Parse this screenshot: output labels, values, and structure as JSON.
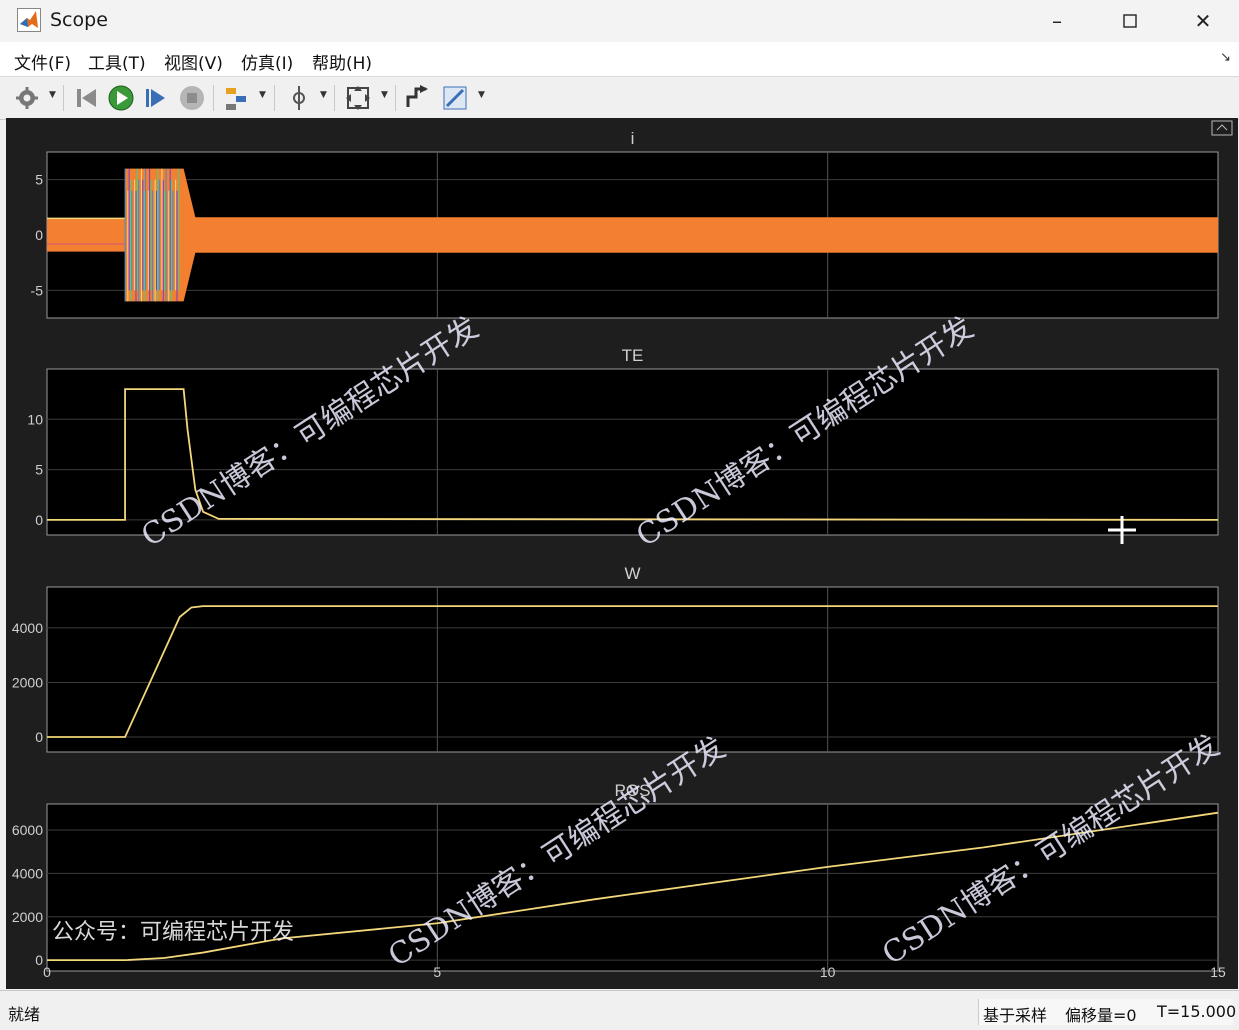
{
  "window": {
    "title": "Scope"
  },
  "menu": [
    {
      "label": "文件(F)"
    },
    {
      "label": "工具(T)"
    },
    {
      "label": "视图(V)"
    },
    {
      "label": "仿真(I)"
    },
    {
      "label": "帮助(H)"
    }
  ],
  "toolbar": {
    "icons": [
      "settings-icon",
      "step-back-icon",
      "run-icon",
      "step-forward-icon",
      "stop-icon",
      "highlight-icon",
      "cursor-measure-icon",
      "zoom-fit-icon",
      "restore-layout-icon",
      "style-icon"
    ]
  },
  "plots": [
    {
      "title": "i",
      "ylim": [
        -7.5,
        7.5
      ],
      "yticks": [
        "5",
        "0",
        "-5"
      ]
    },
    {
      "title": "TE",
      "ylim": [
        -1.5,
        15
      ],
      "yticks": [
        "10",
        "5",
        "0"
      ]
    },
    {
      "title": "W",
      "ylim": [
        -550,
        5500
      ],
      "yticks": [
        "4000",
        "2000",
        "0"
      ]
    },
    {
      "title": "POS",
      "ylim": [
        -500,
        7200
      ],
      "yticks": [
        "6000",
        "4000",
        "2000",
        "0"
      ]
    }
  ],
  "xaxis": {
    "ticks": [
      "0",
      "5",
      "10",
      "15"
    ]
  },
  "chart_data": [
    {
      "type": "line",
      "title": "i",
      "x_range": [
        0,
        15
      ],
      "ylim": [
        -7.5,
        7.5
      ],
      "series": [
        {
          "x": [
            0,
            1,
            1,
            1.75,
            1.9,
            15
          ],
          "values": [
            1.5,
            1.5,
            6,
            6,
            1.6,
            1.6
          ]
        }
      ]
    },
    {
      "type": "line",
      "title": "TE",
      "x_range": [
        0,
        15
      ],
      "ylim": [
        -1.5,
        15
      ],
      "series": [
        {
          "x": [
            0,
            1,
            1,
            1.75,
            1.8,
            1.9,
            2.0,
            2.2,
            15
          ],
          "values": [
            0,
            0,
            13,
            13,
            9,
            3,
            0.8,
            0.1,
            0
          ]
        }
      ]
    },
    {
      "type": "line",
      "title": "W",
      "x_range": [
        0,
        15
      ],
      "ylim": [
        -550,
        5500
      ],
      "series": [
        {
          "x": [
            0,
            1,
            1.7,
            1.85,
            2.0,
            15
          ],
          "values": [
            0,
            0,
            4400,
            4750,
            4800,
            4800
          ]
        }
      ]
    },
    {
      "type": "line",
      "title": "POS",
      "x_range": [
        0,
        15
      ],
      "ylim": [
        -500,
        7200
      ],
      "series": [
        {
          "x": [
            0,
            1,
            1.5,
            2,
            3,
            5,
            7,
            10,
            12,
            15
          ],
          "values": [
            0,
            0,
            100,
            350,
            1000,
            1700,
            2800,
            4300,
            5200,
            6800
          ]
        }
      ]
    }
  ],
  "watermarks": {
    "blog": "CSDN博客：可编程芯片开发",
    "account": "公众号：可编程芯片开发"
  },
  "status": {
    "ready": "就绪",
    "sample": "基于采样",
    "offset": "偏移量=0",
    "time": "T=15.000"
  }
}
